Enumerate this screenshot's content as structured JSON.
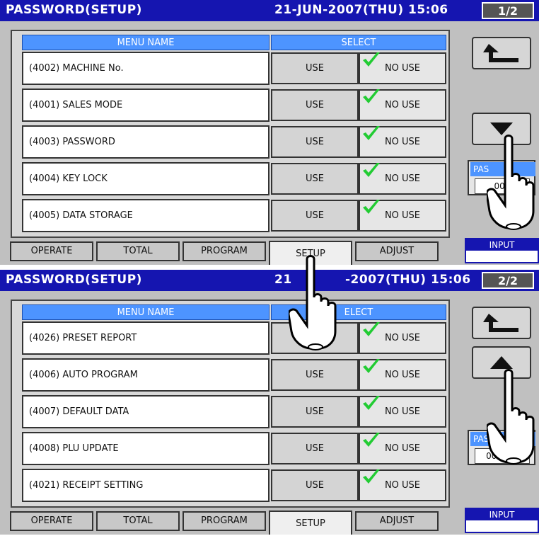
{
  "screens": [
    {
      "title": "PASSWORD(SETUP)",
      "datetime": "21-JUN-2007(THU) 15:06",
      "page": "1/2",
      "menu_header": "MENU NAME",
      "select_header": "SELECT",
      "rows": [
        {
          "label": "(4002) MACHINE No.",
          "use": "USE",
          "no_use": "NO USE",
          "selected": "no_use"
        },
        {
          "label": "(4001) SALES MODE",
          "use": "USE",
          "no_use": "NO USE",
          "selected": "no_use"
        },
        {
          "label": "(4003) PASSWORD",
          "use": "USE",
          "no_use": "NO USE",
          "selected": "no_use"
        },
        {
          "label": "(4004) KEY LOCK",
          "use": "USE",
          "no_use": "NO USE",
          "selected": "no_use"
        },
        {
          "label": "(4005) DATA STORAGE",
          "use": "USE",
          "no_use": "NO USE",
          "selected": "no_use"
        }
      ],
      "tabs": [
        "OPERATE",
        "TOTAL",
        "PROGRAM",
        "SETUP",
        "ADJUST"
      ],
      "active_tab": "SETUP",
      "side_buttons": [
        "back-arrow-icon",
        "down-arrow-icon"
      ],
      "password_label": "PAS",
      "password_value": "000",
      "input_label": "INPUT"
    },
    {
      "title": "PASSWORD(SETUP)",
      "datetime": "21-JUN-2007(THU) 15:06",
      "datetime_parts": [
        "21",
        "-2007(THU)  15:06"
      ],
      "page": "2/2",
      "menu_header": "MENU NAME",
      "select_header": "ELECT",
      "rows": [
        {
          "label": "(4026) PRESET REPORT",
          "use": "",
          "no_use": "NO USE",
          "selected": "no_use"
        },
        {
          "label": "(4006) AUTO PROGRAM",
          "use": "USE",
          "no_use": "NO USE",
          "selected": "no_use"
        },
        {
          "label": "(4007) DEFAULT DATA",
          "use": "USE",
          "no_use": "NO USE",
          "selected": "no_use"
        },
        {
          "label": "(4008) PLU UPDATE",
          "use": "USE",
          "no_use": "NO USE",
          "selected": "no_use"
        },
        {
          "label": "(4021) RECEIPT SETTING",
          "use": "USE",
          "no_use": "NO USE",
          "selected": "no_use"
        }
      ],
      "tabs": [
        "OPERATE",
        "TOTAL",
        "PROGRAM",
        "SETUP",
        "ADJUST"
      ],
      "active_tab": "SETUP",
      "side_buttons": [
        "back-arrow-icon",
        "up-arrow-icon"
      ],
      "password_label": "PASS",
      "password_value": "000000",
      "input_label": "INPUT"
    }
  ],
  "colors": {
    "title_bar": "#1515b0",
    "header_blue": "#4d94ff",
    "check_green": "#22cc33",
    "panel_gray": "#c0c0c0"
  }
}
